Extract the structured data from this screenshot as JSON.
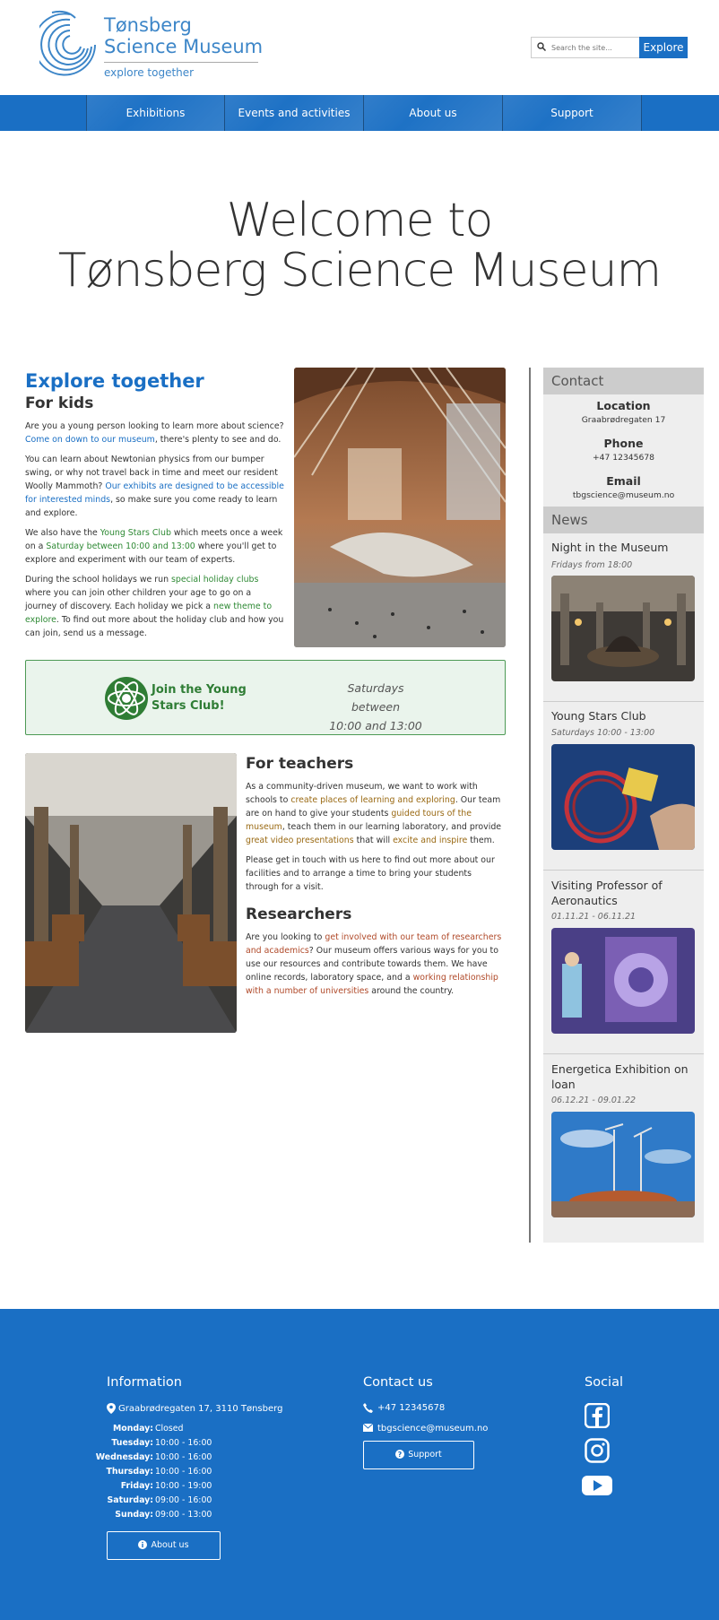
{
  "header": {
    "logo_line1": "Tønsberg",
    "logo_line2": "Science Museum",
    "logo_tagline": "explore together",
    "search_placeholder": "Search the site...",
    "search_button": "Explore"
  },
  "nav": {
    "items": [
      "Exhibitions",
      "Events and activities",
      "About us",
      "Support"
    ]
  },
  "hero": {
    "line1": "Welcome to",
    "line2": "Tønsberg Science Museum"
  },
  "main": {
    "explore_heading": "Explore together",
    "kids_heading": "For kids",
    "kids_p1_a": "Are you a young person looking to learn more about science? ",
    "kids_p1_link": "Come on down to our museum",
    "kids_p1_b": ", there's plenty to see and do.",
    "kids_p2_a": "You can learn about Newtonian physics from our bumper swing, or why not travel back in time and meet our resident Woolly Mammoth? ",
    "kids_p2_link": "Our exhibits are designed to be accessible for interested minds",
    "kids_p2_b": ", so make sure you come ready to learn and explore.",
    "kids_p3_a": "We also have the ",
    "kids_p3_link1": "Young Stars Club",
    "kids_p3_b": " which meets once a week on a ",
    "kids_p3_link2": "Saturday between 10:00 and 13:00",
    "kids_p3_c": " where you'll get to explore and experiment with our team of experts.",
    "kids_p4_a": "During the school holidays we run ",
    "kids_p4_link1": "special holiday clubs",
    "kids_p4_b": " where you can join other children your age to go on a journey of discovery. Each holiday we pick a ",
    "kids_p4_link2": "new theme to explore",
    "kids_p4_c": ". To find out more about the holiday club and how you can join, send us a message.",
    "club_title": "Join the Young Stars Club!",
    "club_time_line1": "Saturdays between",
    "club_time_line2": "10:00 and 13:00",
    "teachers_heading": "For teachers",
    "teachers_p1_a": "As a community-driven museum, we want to work with schools to ",
    "teachers_p1_link1": "create places of learning and exploring",
    "teachers_p1_b": ". Our team are on hand to give your students ",
    "teachers_p1_link2": "guided tours of the museum",
    "teachers_p1_c": ", teach them in our learning laboratory, and provide ",
    "teachers_p1_link3": "great video presentations",
    "teachers_p1_d": " that will ",
    "teachers_p1_link4": "excite and inspire",
    "teachers_p1_e": " them.",
    "teachers_p2": "Please get in touch with us here to find out more about our facilities and to arrange a time to bring your students through for a visit.",
    "researchers_heading": "Researchers",
    "researchers_p_a": "Are you looking to ",
    "researchers_p_link1": "get involved with our team of researchers and academics",
    "researchers_p_b": "? Our museum offers various ways for you to use our resources and contribute towards them. We have online records, laboratory space, and a ",
    "researchers_p_link2": "working relationship with a number of universities",
    "researchers_p_c": " around the country."
  },
  "sidebar": {
    "contact_heading": "Contact",
    "location_label": "Location",
    "location_value": "Graabrødregaten 17",
    "phone_label": "Phone",
    "phone_value": "+47 12345678",
    "email_label": "Email",
    "email_value": "tbgscience@museum.no",
    "news_heading": "News",
    "news": [
      {
        "title": "Night in the Museum",
        "date": "Fridays from 18:00"
      },
      {
        "title": "Young Stars Club",
        "date": "Saturdays 10:00 - 13:00"
      },
      {
        "title": "Visiting Professor of Aeronautics",
        "date": "01.11.21 - 06.11.21"
      },
      {
        "title": "Energetica Exhibition on loan",
        "date": "06.12.21 - 09.01.22"
      }
    ]
  },
  "footer": {
    "info_heading": "Information",
    "address": "Graabrødregaten 17, 3110 Tønsberg",
    "hours": [
      {
        "day": "Monday:",
        "time": "Closed"
      },
      {
        "day": "Tuesday:",
        "time": "10:00 - 16:00"
      },
      {
        "day": "Wednesday:",
        "time": "10:00 - 16:00"
      },
      {
        "day": "Thursday:",
        "time": "10:00 - 16:00"
      },
      {
        "day": "Friday:",
        "time": "10:00 - 19:00"
      },
      {
        "day": "Saturday:",
        "time": "09:00 - 16:00"
      },
      {
        "day": "Sunday:",
        "time": "09:00 - 13:00"
      }
    ],
    "about_button": "About us",
    "contact_heading": "Contact us",
    "phone": "+47 12345678",
    "email": "tbgscience@museum.no",
    "support_button": "Support",
    "social_heading": "Social"
  },
  "colors": {
    "brand_blue": "#1a6fc4",
    "club_green": "#2f7d35",
    "sidebar_gray": "#eeeeee"
  },
  "icons": [
    "search-icon",
    "map-pin-icon",
    "phone-icon",
    "envelope-icon",
    "info-icon",
    "question-icon",
    "facebook-icon",
    "instagram-icon",
    "youtube-icon",
    "atom-icon"
  ]
}
